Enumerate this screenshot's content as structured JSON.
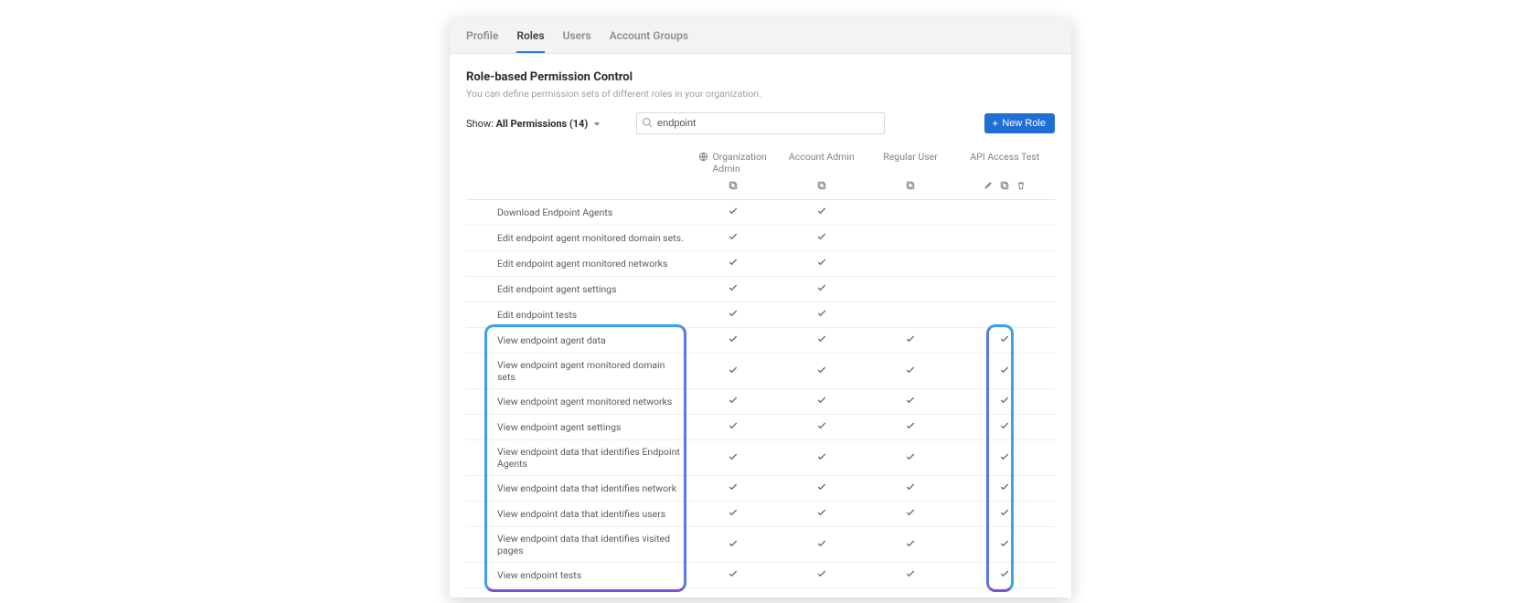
{
  "tabs": {
    "items": [
      {
        "label": "Profile",
        "active": false
      },
      {
        "label": "Roles",
        "active": true
      },
      {
        "label": "Users",
        "active": false
      },
      {
        "label": "Account Groups",
        "active": false
      }
    ]
  },
  "page": {
    "title": "Role-based Permission Control",
    "subtitle": "You can define permission sets of different roles in your organization."
  },
  "filter": {
    "show_prefix": "Show:",
    "show_value": "All Permissions (14)",
    "search_value": "endpoint"
  },
  "buttons": {
    "new_role": "New Role"
  },
  "roles": [
    {
      "name": "Organization Admin",
      "is_org": true,
      "actions": [
        "copy"
      ]
    },
    {
      "name": "Account Admin",
      "is_org": false,
      "actions": [
        "copy"
      ]
    },
    {
      "name": "Regular User",
      "is_org": false,
      "actions": [
        "copy"
      ]
    },
    {
      "name": "API Access Test",
      "is_org": false,
      "actions": [
        "edit",
        "copy",
        "delete"
      ]
    }
  ],
  "permissions": [
    {
      "label": "Download Endpoint Agents",
      "checks": [
        true,
        true,
        false,
        false
      ],
      "group": "top"
    },
    {
      "label": "Edit endpoint agent monitored domain sets.",
      "checks": [
        true,
        true,
        false,
        false
      ],
      "group": "top"
    },
    {
      "label": "Edit endpoint agent monitored networks",
      "checks": [
        true,
        true,
        false,
        false
      ],
      "group": "top"
    },
    {
      "label": "Edit endpoint agent settings",
      "checks": [
        true,
        true,
        false,
        false
      ],
      "group": "top"
    },
    {
      "label": "Edit endpoint tests",
      "checks": [
        true,
        true,
        false,
        false
      ],
      "group": "top"
    },
    {
      "label": "View endpoint agent data",
      "checks": [
        true,
        true,
        true,
        true
      ],
      "group": "view"
    },
    {
      "label": "View endpoint agent monitored domain sets",
      "checks": [
        true,
        true,
        true,
        true
      ],
      "group": "view"
    },
    {
      "label": "View endpoint agent monitored networks",
      "checks": [
        true,
        true,
        true,
        true
      ],
      "group": "view"
    },
    {
      "label": "View endpoint agent settings",
      "checks": [
        true,
        true,
        true,
        true
      ],
      "group": "view"
    },
    {
      "label": "View endpoint data that identifies Endpoint Agents",
      "checks": [
        true,
        true,
        true,
        true
      ],
      "group": "view"
    },
    {
      "label": "View endpoint data that identifies network",
      "checks": [
        true,
        true,
        true,
        true
      ],
      "group": "view"
    },
    {
      "label": "View endpoint data that identifies users",
      "checks": [
        true,
        true,
        true,
        true
      ],
      "group": "view"
    },
    {
      "label": "View endpoint data that identifies visited pages",
      "checks": [
        true,
        true,
        true,
        true
      ],
      "group": "view"
    },
    {
      "label": "View endpoint tests",
      "checks": [
        true,
        true,
        true,
        true
      ],
      "group": "view"
    }
  ]
}
